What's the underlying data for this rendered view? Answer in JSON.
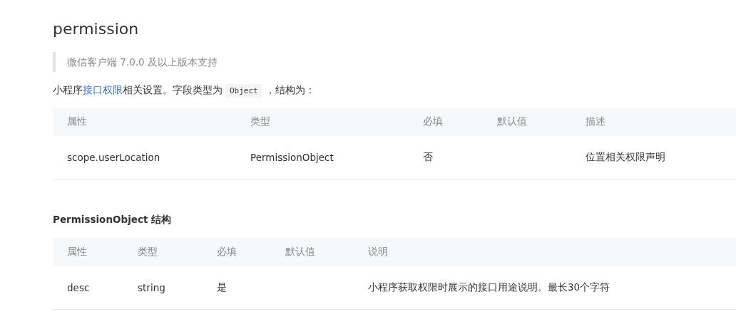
{
  "title": "permission",
  "note": "微信客户端 7.0.0 及以上版本支持",
  "intro": {
    "before": "小程序",
    "link": "接口权限",
    "middle": "相关设置。字段类型为",
    "code": "Object",
    "after": "，结构为："
  },
  "table": {
    "columns": [
      "属性",
      "类型",
      "必填",
      "默认值",
      "描述"
    ],
    "rows": [
      [
        "scope.userLocation",
        "PermissionObject",
        "否",
        "",
        "位置相关权限声明"
      ]
    ]
  },
  "subheading": "PermissionObject 结构",
  "table2": {
    "columns": [
      "属性",
      "类型",
      "必填",
      "默认值",
      "说明"
    ],
    "rows": [
      [
        "desc",
        "string",
        "是",
        "",
        "小程序获取权限时展示的接口用途说明。最长30个字符"
      ]
    ]
  }
}
